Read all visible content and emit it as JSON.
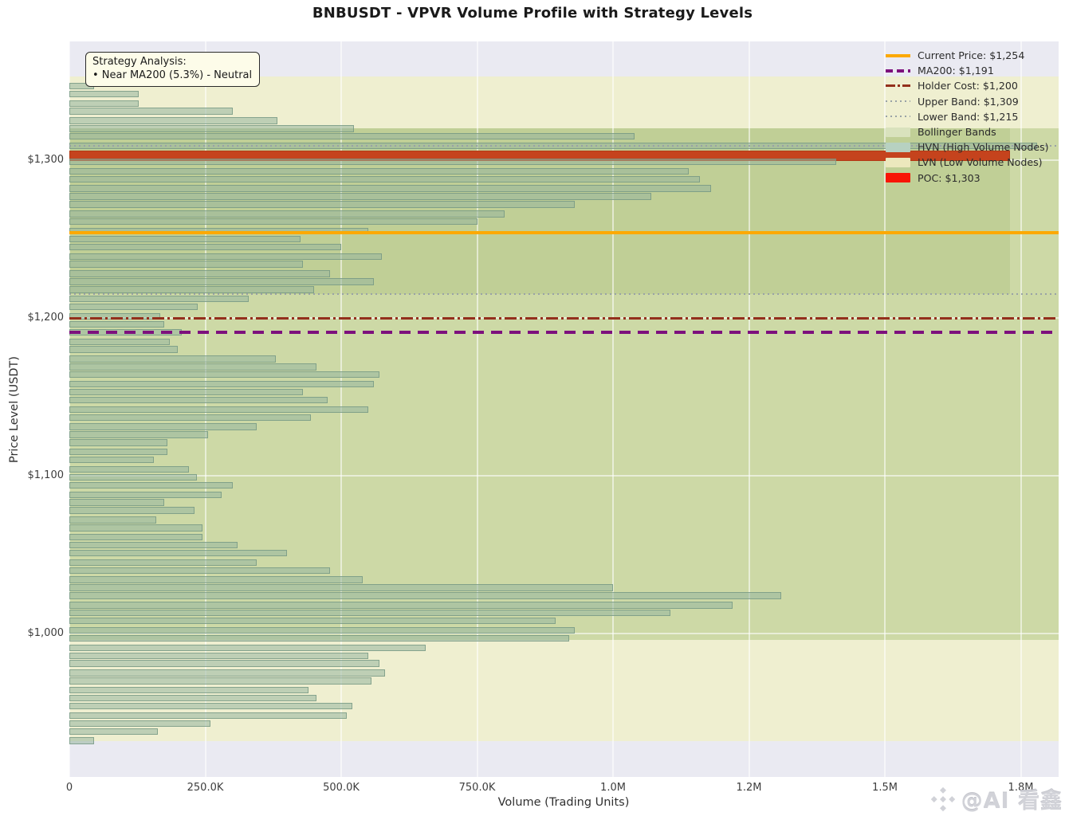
{
  "title": "BNBUSDT - VPVR Volume Profile with Strategy Levels",
  "axes": {
    "x_label": "Volume (Trading Units)",
    "y_label": "Price Level (USDT)",
    "x_ticks": [
      "0",
      "250.0K",
      "500.0K",
      "750.0K",
      "1.0M",
      "1.2M",
      "1.5M",
      "1.8M"
    ],
    "y_ticks": [
      "$1,300",
      "$1,200",
      "$1,100",
      "$1,000"
    ]
  },
  "annotation": {
    "line1": "Strategy Analysis:",
    "line2": "• Near MA200 (5.3%) - Neutral"
  },
  "legend": [
    {
      "label": "Current Price: $1,254",
      "type": "line",
      "style": "solid",
      "color": "#fca903"
    },
    {
      "label": "MA200: $1,191",
      "type": "line",
      "style": "dashed",
      "color": "#7d107d"
    },
    {
      "label": "Holder Cost: $1,200",
      "type": "line",
      "style": "dashdot",
      "color": "#93301c"
    },
    {
      "label": "Upper Band: $1,309",
      "type": "line",
      "style": "dotted",
      "color": "#99a2a6"
    },
    {
      "label": "Lower Band: $1,215",
      "type": "line",
      "style": "dotted",
      "color": "#99a2a6"
    },
    {
      "label": "Bollinger Bands",
      "type": "patch",
      "color": "#d9e2bd"
    },
    {
      "label": "HVN (High Volume Nodes)",
      "type": "patch",
      "color": "#b7d1c1"
    },
    {
      "label": "LVN (Low Volume Nodes)",
      "type": "patch",
      "color": "#ece8bd"
    },
    {
      "label": "POC: $1,303",
      "type": "patch",
      "color": "#f81505"
    }
  ],
  "watermark": "@AI 看鑫",
  "chart_data": {
    "type": "bar",
    "orientation": "horizontal",
    "title": "BNBUSDT - VPVR Volume Profile with Strategy Levels",
    "xlabel": "Volume (Trading Units)",
    "ylabel": "Price Level (USDT)",
    "xlim": [
      0,
      1750000
    ],
    "ylim": [
      908,
      1374
    ],
    "grid": true,
    "legend_position": "upper right",
    "levels": {
      "current_price": 1254,
      "ma200": 1191,
      "holder_cost": 1200,
      "upper_band": 1309,
      "lower_band": 1215,
      "poc": 1303
    },
    "zones": {
      "lvn": [
        [
          1320,
          1353
        ],
        [
          932,
          996
        ]
      ],
      "hvn": [
        [
          996,
          1320
        ]
      ],
      "bollinger": [
        1215,
        1309
      ],
      "bollinger_draw": [
        1215,
        1320
      ]
    },
    "poc_bar": {
      "price": 1303,
      "volume": 1730000
    },
    "bins": [
      {
        "p": 1347,
        "v": 45000
      },
      {
        "p": 1342,
        "v": 127000
      },
      {
        "p": 1336,
        "v": 127000
      },
      {
        "p": 1331,
        "v": 300000
      },
      {
        "p": 1325,
        "v": 382000
      },
      {
        "p": 1320,
        "v": 523000
      },
      {
        "p": 1315,
        "v": 1040000
      },
      {
        "p": 1309,
        "v": 1780000
      },
      {
        "p": 1303,
        "v": 1730000,
        "poc": true
      },
      {
        "p": 1299,
        "v": 1410000
      },
      {
        "p": 1293,
        "v": 1140000
      },
      {
        "p": 1288,
        "v": 1160000
      },
      {
        "p": 1282,
        "v": 1180000
      },
      {
        "p": 1277,
        "v": 1070000
      },
      {
        "p": 1272,
        "v": 930000
      },
      {
        "p": 1266,
        "v": 800000
      },
      {
        "p": 1261,
        "v": 750000
      },
      {
        "p": 1255,
        "v": 550000
      },
      {
        "p": 1250,
        "v": 425000
      },
      {
        "p": 1245,
        "v": 500000
      },
      {
        "p": 1239,
        "v": 575000
      },
      {
        "p": 1234,
        "v": 430000
      },
      {
        "p": 1228,
        "v": 480000
      },
      {
        "p": 1223,
        "v": 560000
      },
      {
        "p": 1218,
        "v": 450000
      },
      {
        "p": 1212,
        "v": 330000
      },
      {
        "p": 1207,
        "v": 236000
      },
      {
        "p": 1201,
        "v": 167000
      },
      {
        "p": 1196,
        "v": 175000
      },
      {
        "p": 1191,
        "v": 207000
      },
      {
        "p": 1185,
        "v": 185000
      },
      {
        "p": 1180,
        "v": 200000
      },
      {
        "p": 1174,
        "v": 380000
      },
      {
        "p": 1169,
        "v": 455000
      },
      {
        "p": 1164,
        "v": 570000
      },
      {
        "p": 1158,
        "v": 560000
      },
      {
        "p": 1153,
        "v": 430000
      },
      {
        "p": 1148,
        "v": 475000
      },
      {
        "p": 1142,
        "v": 550000
      },
      {
        "p": 1137,
        "v": 445000
      },
      {
        "p": 1131,
        "v": 345000
      },
      {
        "p": 1126,
        "v": 255000
      },
      {
        "p": 1121,
        "v": 180000
      },
      {
        "p": 1115,
        "v": 180000
      },
      {
        "p": 1110,
        "v": 155000
      },
      {
        "p": 1104,
        "v": 220000
      },
      {
        "p": 1099,
        "v": 235000
      },
      {
        "p": 1094,
        "v": 300000
      },
      {
        "p": 1088,
        "v": 280000
      },
      {
        "p": 1083,
        "v": 175000
      },
      {
        "p": 1078,
        "v": 230000
      },
      {
        "p": 1072,
        "v": 160000
      },
      {
        "p": 1067,
        "v": 245000
      },
      {
        "p": 1061,
        "v": 245000
      },
      {
        "p": 1056,
        "v": 310000
      },
      {
        "p": 1051,
        "v": 400000
      },
      {
        "p": 1045,
        "v": 345000
      },
      {
        "p": 1040,
        "v": 480000
      },
      {
        "p": 1034,
        "v": 540000
      },
      {
        "p": 1029,
        "v": 1000000
      },
      {
        "p": 1024,
        "v": 1310000
      },
      {
        "p": 1018,
        "v": 1220000
      },
      {
        "p": 1013,
        "v": 1105000
      },
      {
        "p": 1008,
        "v": 895000
      },
      {
        "p": 1002,
        "v": 930000
      },
      {
        "p": 997,
        "v": 920000
      },
      {
        "p": 991,
        "v": 655000
      },
      {
        "p": 986,
        "v": 550000
      },
      {
        "p": 981,
        "v": 570000
      },
      {
        "p": 975,
        "v": 580000
      },
      {
        "p": 970,
        "v": 555000
      },
      {
        "p": 964,
        "v": 440000
      },
      {
        "p": 959,
        "v": 455000
      },
      {
        "p": 954,
        "v": 520000
      },
      {
        "p": 948,
        "v": 510000
      },
      {
        "p": 943,
        "v": 260000
      },
      {
        "p": 938,
        "v": 163000
      },
      {
        "p": 932,
        "v": 45000
      }
    ]
  }
}
